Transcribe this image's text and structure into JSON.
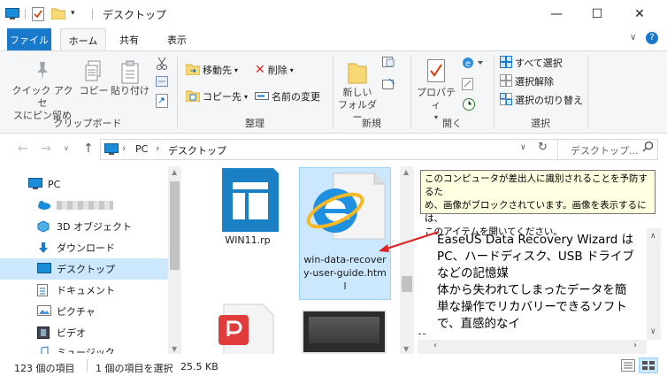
{
  "window": {
    "title": "デスクトップ",
    "minimize": "—",
    "maximize": "☐",
    "close": "✕"
  },
  "tabs": {
    "file": "ファイル",
    "home": "ホーム",
    "share": "共有",
    "view": "表示"
  },
  "ribbon": {
    "clipboard": {
      "label": "クリップボード",
      "pin_line1": "クイック アクセ",
      "pin_line2": "スにピン留め",
      "copy": "コピー",
      "paste": "貼り付け"
    },
    "organize": {
      "label": "整理",
      "move_to": "移動先",
      "copy_to": "コピー先",
      "delete": "削除",
      "rename": "名前の変更"
    },
    "new": {
      "label": "新規",
      "new_folder_line1": "新しい",
      "new_folder_line2": "フォルダー"
    },
    "open": {
      "label": "開く",
      "properties": "プロパティ"
    },
    "select": {
      "label": "選択",
      "select_all": "すべて選択",
      "select_none": "選択解除",
      "invert": "選択の切り替え"
    }
  },
  "address": {
    "crumbs": [
      "PC",
      "デスクトップ"
    ],
    "search_placeholder": "デスクトップ..."
  },
  "tree": {
    "items": [
      {
        "label": "PC"
      },
      {
        "label": ""
      },
      {
        "label": "3D オブジェクト"
      },
      {
        "label": "ダウンロード"
      },
      {
        "label": "デスクトップ"
      },
      {
        "label": "ドキュメント"
      },
      {
        "label": "ピクチャ"
      },
      {
        "label": "ビデオ"
      },
      {
        "label": "ミュージック"
      }
    ]
  },
  "files": {
    "item1": "WIN11.rp",
    "item2_line1": "win-data-recover",
    "item2_line2": "y-user-guide.htm",
    "item2_line3": "l"
  },
  "preview": {
    "tooltip_line1": "このコンピュータが差出人に識別されることを予防するた",
    "tooltip_line2": "め、画像がブロックされています。画像を表示するには、",
    "tooltip_line3": "このアイテムを開いてください。",
    "text_line1": "EaseUS Data Recovery Wizard は",
    "text_line2": "PC、ハードディスク、USB ドライブ",
    "text_line3": "などの記憶媒",
    "text_line4": "体から失われてしまったデータを簡",
    "text_line5": "単な操作でリカバリーできるソフト",
    "text_line6": "で、直感的なイ"
  },
  "status": {
    "count": "123 個の項目",
    "selected": "1 個の項目を選択",
    "size": "25.5 KB"
  },
  "colors": {
    "file_tab": "#1979ca",
    "selection": "#cce8ff",
    "tooltip_bg": "#ffffe1"
  }
}
